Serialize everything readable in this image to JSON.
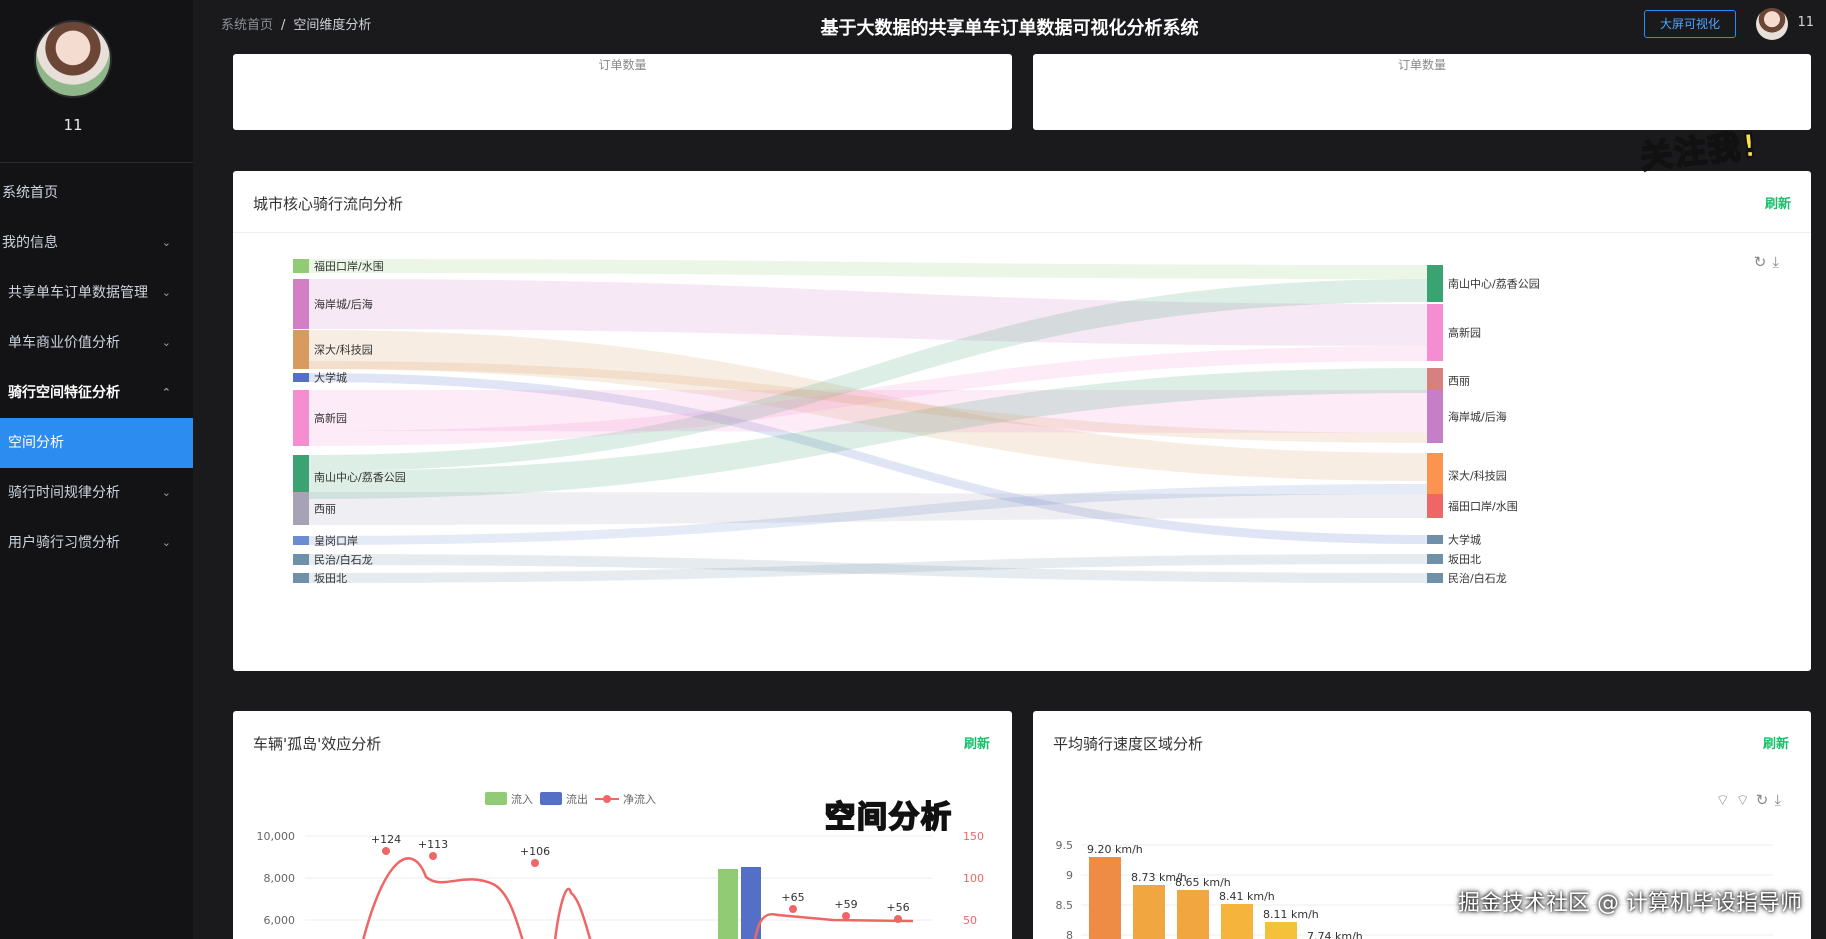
{
  "sidebar": {
    "user_name": "11",
    "menu": [
      {
        "label": "系统首页",
        "has_chevron": false
      },
      {
        "label": "我的信息",
        "has_chevron": true
      },
      {
        "label": "共享单车订单数据管理",
        "has_chevron": true
      },
      {
        "label": "单车商业价值分析",
        "has_chevron": true
      },
      {
        "label": "骑行空间特征分析",
        "has_chevron": true,
        "expanded": true
      },
      {
        "label": "空间分析",
        "active": true
      },
      {
        "label": "骑行时间规律分析",
        "has_chevron": true
      },
      {
        "label": "用户骑行习惯分析",
        "has_chevron": true
      }
    ]
  },
  "header": {
    "breadcrumb_home": "系统首页",
    "breadcrumb_sep": "/",
    "breadcrumb_current": "空间维度分析",
    "title": "基于大数据的共享单车订单数据可视化分析系统",
    "big_screen_button": "大屏可视化",
    "user_name": "11"
  },
  "top_cards": {
    "left_label": "订单数量",
    "right_label": "订单数量"
  },
  "flow_card": {
    "title": "城市核心骑行流向分析",
    "refresh": "刷新"
  },
  "island_card": {
    "title": "车辆'孤岛'效应分析",
    "refresh": "刷新",
    "legend": [
      "流入",
      "流出",
      "净流入"
    ],
    "left_axis_ticks": [
      "10,000",
      "8,000",
      "6,000"
    ],
    "right_axis_ticks": [
      "150",
      "100",
      "50"
    ],
    "net_labels": [
      "+124",
      "+113",
      "+106",
      "+65",
      "+59",
      "+56"
    ]
  },
  "speed_card": {
    "title": "平均骑行速度区域分析",
    "refresh": "刷新",
    "axis_ticks": [
      "9.5",
      "9",
      "8.5",
      "8"
    ],
    "bar_labels": [
      "9.20 km/h",
      "8.73 km/h",
      "8.65 km/h",
      "8.41 km/h",
      "8.11 km/h",
      "7.74 km/h"
    ]
  },
  "stickers": {
    "follow": "关注我!",
    "space": "空间分析"
  },
  "watermark": "掘金技术社区 @ 计算机毕设指导师",
  "chart_data": {
    "type": "sankey",
    "title": "城市核心骑行流向分析",
    "source_nodes": [
      {
        "name": "福田口岸/水围",
        "color": "#91cc75"
      },
      {
        "name": "海岸城/后海",
        "color": "#d27fc6"
      },
      {
        "name": "深大/科技园",
        "color": "#d89b5e"
      },
      {
        "name": "大学城",
        "color": "#5470c6"
      },
      {
        "name": "高新园",
        "color": "#f58ed1"
      },
      {
        "name": "南山中心/荔香公园",
        "color": "#3ba272"
      },
      {
        "name": "西丽",
        "color": "#a7a3b5"
      },
      {
        "name": "皇岗口岸",
        "color": "#6b8ccf"
      },
      {
        "name": "民治/白石龙",
        "color": "#6e90a8"
      },
      {
        "name": "坂田北",
        "color": "#6e90a8"
      }
    ],
    "target_nodes": [
      {
        "name": "南山中心/荔香公园",
        "color": "#3ba272"
      },
      {
        "name": "高新园",
        "color": "#f58ed1"
      },
      {
        "name": "西丽",
        "color": "#d88080"
      },
      {
        "name": "海岸城/后海",
        "color": "#c47fc6"
      },
      {
        "name": "深大/科技园",
        "color": "#fc9350"
      },
      {
        "name": "福田口岸/水围",
        "color": "#ee6666"
      },
      {
        "name": "大学城",
        "color": "#6e90a8"
      },
      {
        "name": "坂田北",
        "color": "#6e90a8"
      },
      {
        "name": "民治/白石龙",
        "color": "#6e90a8"
      }
    ]
  }
}
